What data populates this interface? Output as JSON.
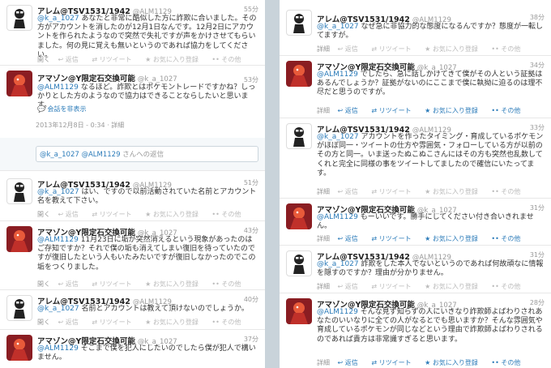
{
  "left": {
    "tweets": [
      {
        "name": "アレム@TSV1531/1942",
        "handle": "@ALM1129",
        "time": "55分",
        "mention": "@k_a_1027",
        "text": " あなたと非常に酷似した方に詐欺に合いました。その方がアカウントを消したのが12月1日なんです。12月2日にアカウントを作られたようなので突然で失礼ですが声をかけさせてもらいました。何の見に覚えも無いというのであれば協力をしてください。",
        "actions": [
          "開く",
          "返信",
          "リツイート",
          "お気に入り登録",
          "その他"
        ],
        "avatar": "alem-avatar"
      },
      {
        "name": "アマゾン@Y限定石交換可能",
        "handle": "@k_a_1027",
        "time": "53分",
        "mention": "@ALM1129",
        "text": " なるほど。詐欺とはポケモントレードですかね？しっかりとした方のようなので協力はできることならしたいと思います。",
        "conversation": "会話を非表示",
        "timestamp": "2013年12月8日 - 0:34 · 詳細",
        "actions": [
          "返信",
          "リツイート",
          "お気に入り登録",
          "その他"
        ],
        "avatar": "amazon-avatar"
      },
      {
        "name": "アレム@TSV1531/1942",
        "handle": "@ALM1129",
        "time": "51分",
        "mention": "@k_a_1027",
        "text": " はい、ですので以前活動されていた名前とアカウント名を教えて下さい。",
        "actions": [
          "開く",
          "返信",
          "リツイート",
          "お気に入り登録",
          "その他"
        ],
        "avatar": "alem-avatar"
      },
      {
        "name": "アマゾン@Y限定石交換可能",
        "handle": "@k_a_1027",
        "time": "43分",
        "mention": "@ALM1129",
        "text": " 11月23日に垢が突然消えるという現象があったのはご存知ですか？それで僕の垢も消えてしまい復旧を待っていたのですが復旧したという人もいたみたいですが復旧しなかったのでこの垢をつくりました。",
        "actions": [
          "開く",
          "返信",
          "リツイート",
          "お気に入り登録",
          "その他"
        ],
        "avatar": "amazon-avatar"
      },
      {
        "name": "アレム@TSV1531/1942",
        "handle": "@ALM1129",
        "time": "40分",
        "mention": "@k_a_1027",
        "text": " 名前とアカウントは教えて頂けないのでしょうか。",
        "actions": [
          "開く",
          "返信",
          "リツイート",
          "お気に入り登録",
          "その他"
        ],
        "avatar": "alem-avatar"
      },
      {
        "name": "アマゾン@Y限定石交換可能",
        "handle": "@k_a_1027",
        "time": "37分",
        "mention": "@ALM1129",
        "text": " そこまで僕を犯人にしたいのでしたら僕が犯人で構いません。",
        "actions": [],
        "avatar": "amazon-avatar"
      }
    ],
    "reply_prefix": "@k_a_1027 @ALM1129",
    "reply_suffix": " さんへの返信"
  },
  "right": {
    "tweets": [
      {
        "name": "アレム@TSV1531/1942",
        "handle": "@ALM1129",
        "time": "38分",
        "mention": "@k_a_1027",
        "text": " なぜ急に非協力的な態度になるんですか？態度が一転してますが。",
        "actions": [
          "詳細",
          "返信",
          "リツイート",
          "お気に入り登録",
          "その他"
        ],
        "avatar": "alem-avatar"
      },
      {
        "name": "アマゾン@Y限定石交換可能",
        "handle": "@k_a_1027",
        "time": "34分",
        "mention": "@ALM1129",
        "text": " でしたら、急に話しかけてきて僕がその人という証拠はあるんでしょうか？証拠がないのにここまで僕に執拗に迫るのは理不尽だと思うのですが。",
        "actions": [
          "詳細",
          "返信",
          "リツイート",
          "お気に入り登録",
          "その他"
        ],
        "avatar": "amazon-avatar"
      },
      {
        "name": "アレム@TSV1531/1942",
        "handle": "@ALM1129",
        "time": "33分",
        "mention": "@k_a_1027",
        "text": " アカウントを作ったタイミング・育成しているポケモンがほぼ同一・ツイートの仕方や雰囲気・フォローしている方が以前のその方と同一。いま送ったぬこぬこさんにはその方も突然也乱数してくれと完全に同様の事をツイートしてましたので確信にいたってます。",
        "actions": [
          "詳細",
          "返信",
          "リツイート",
          "お気に入り登録",
          "その他"
        ],
        "avatar": "alem-avatar"
      },
      {
        "name": "アマゾン@Y限定石交換可能",
        "handle": "@k_a_1027",
        "time": "31分",
        "mention": "@ALM1129",
        "text": " もーいいです。勝手にしてください付き合いきれません。",
        "actions": [
          "詳細",
          "返信",
          "リツイート",
          "お気に入り登録",
          "その他"
        ],
        "avatar": "amazon-avatar"
      },
      {
        "name": "アレム@TSV1531/1942",
        "handle": "@ALM1129",
        "time": "31分",
        "mention": "@k_a_1027",
        "text": " 詐欺をした本人でないというのであれば何故頑なに情報を隠すのですか？理由が分かりません。",
        "actions": [
          "詳細",
          "返信",
          "リツイート",
          "お気に入り登録",
          "その他"
        ],
        "avatar": "alem-avatar"
      },
      {
        "name": "アマゾン@Y限定石交換可能",
        "handle": "@k_a_1027",
        "time": "28分",
        "mention": "@ALM1129",
        "text": " そんな見ず知らずの人にいきなり詐欺師よばわりされあなたのいいなりに全ての人がなるとでも思いますか？そんな雰囲気や育成しているポケモンが同じなどという理由で詐欺師よばわりされるのであれば貴方は非常識すぎると思います。",
        "actions": [
          "詳細",
          "返信",
          "リツイート",
          "お気に入り登録",
          "その他"
        ],
        "avatar": "amazon-avatar"
      }
    ]
  }
}
